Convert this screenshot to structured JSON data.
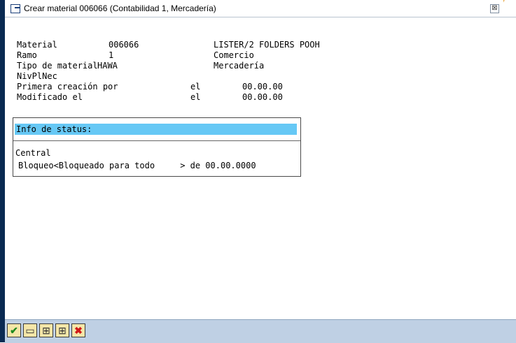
{
  "window": {
    "title": "Crear material 006066 (Contabilidad 1, Mercadería)",
    "close_symbol": "⊠"
  },
  "header_info": {
    "material_label": "Material",
    "material_value": "006066",
    "material_desc": "LISTER/2 FOLDERS POOH",
    "ramo_label": "Ramo",
    "ramo_value": "1",
    "ramo_desc": "Comercio",
    "tipo_label": "Tipo de material",
    "tipo_value": "HAWA",
    "tipo_desc": "Mercadería",
    "nivplnec_label": "NivPlNec",
    "primera_label": "Primera creación por",
    "primera_el": "el",
    "primera_date": "00.00.00",
    "modificado_label": "Modificado el",
    "modificado_el": "el",
    "modificado_date": "00.00.00"
  },
  "status_box": {
    "header": "Info de status:",
    "central": "Central",
    "bloqueo": "Bloqueo<Bloqueado para todo     > de 00.00.0000"
  },
  "toolbar": {
    "buttons": [
      {
        "name": "confirm",
        "icon": "check-icon",
        "symbol": "✔",
        "color": "#1e8a1e"
      },
      {
        "name": "print",
        "icon": "print-icon",
        "symbol": "▭",
        "color": "#333333"
      },
      {
        "name": "find",
        "icon": "find-icon",
        "symbol": "⊞",
        "color": "#333333"
      },
      {
        "name": "find-next",
        "icon": "find-next-icon",
        "symbol": "⊞",
        "color": "#333333"
      },
      {
        "name": "cancel",
        "icon": "cancel-icon",
        "symbol": "✖",
        "color": "#d01818"
      }
    ]
  }
}
